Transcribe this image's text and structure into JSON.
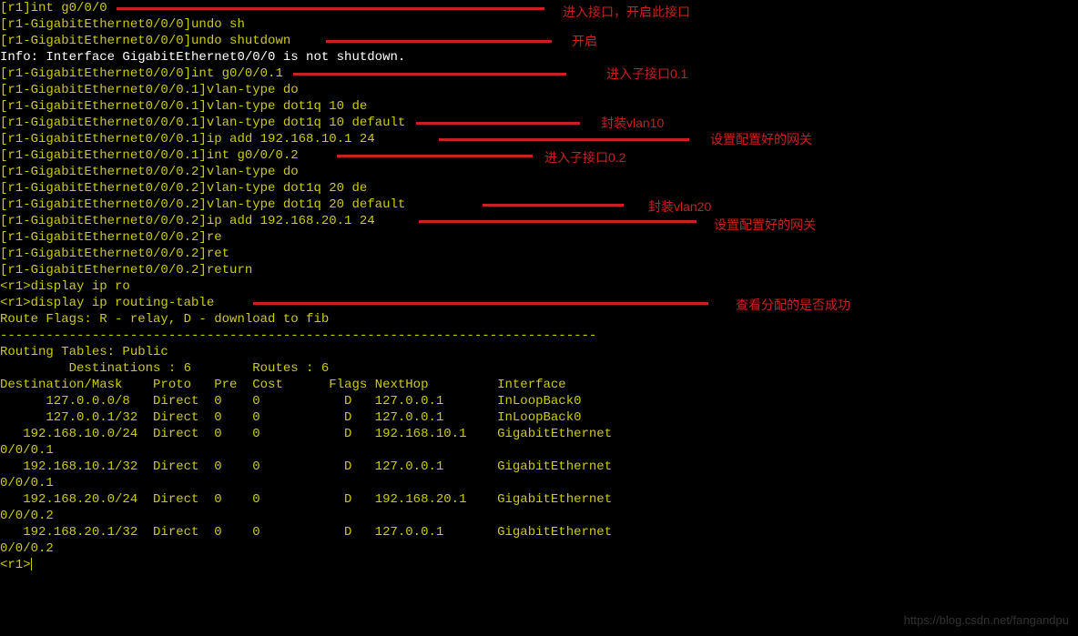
{
  "lines": {
    "l0": "[r1]int g0/0/0",
    "l1": "[r1-GigabitEthernet0/0/0]undo sh",
    "l2": "[r1-GigabitEthernet0/0/0]undo shutdown",
    "l3": "Info: Interface GigabitEthernet0/0/0 is not shutdown.",
    "l4": "[r1-GigabitEthernet0/0/0]int g0/0/0.1",
    "l5": "[r1-GigabitEthernet0/0/0.1]vlan-type do",
    "l6": "[r1-GigabitEthernet0/0/0.1]vlan-type dot1q 10 de",
    "l7": "[r1-GigabitEthernet0/0/0.1]vlan-type dot1q 10 default",
    "l8": "[r1-GigabitEthernet0/0/0.1]ip add 192.168.10.1 24",
    "l9": "[r1-GigabitEthernet0/0/0.1]int g0/0/0.2",
    "l10": "[r1-GigabitEthernet0/0/0.2]vlan-type do",
    "l11": "[r1-GigabitEthernet0/0/0.2]vlan-type dot1q 20 de",
    "l12": "[r1-GigabitEthernet0/0/0.2]vlan-type dot1q 20 default",
    "l13": "[r1-GigabitEthernet0/0/0.2]ip add 192.168.20.1 24",
    "l14": "[r1-GigabitEthernet0/0/0.2]re",
    "l15": "[r1-GigabitEthernet0/0/0.2]ret",
    "l16": "[r1-GigabitEthernet0/0/0.2]return",
    "l17": "<r1>display ip ro",
    "l18": "<r1>display ip routing-table",
    "l19": "Route Flags: R - relay, D - download to fib",
    "l20": "------------------------------------------------------------------------------",
    "l21": "Routing Tables: Public",
    "l22": "         Destinations : 6        Routes : 6",
    "l23": "",
    "l24": "Destination/Mask    Proto   Pre  Cost      Flags NextHop         Interface",
    "l25": "",
    "l26": "      127.0.0.0/8   Direct  0    0           D   127.0.0.1       InLoopBack0",
    "l27": "      127.0.0.1/32  Direct  0    0           D   127.0.0.1       InLoopBack0",
    "l28": "   192.168.10.0/24  Direct  0    0           D   192.168.10.1    GigabitEthernet",
    "l29": "0/0/0.1",
    "l30": "   192.168.10.1/32  Direct  0    0           D   127.0.0.1       GigabitEthernet",
    "l31": "0/0/0.1",
    "l32": "   192.168.20.0/24  Direct  0    0           D   192.168.20.1    GigabitEthernet",
    "l33": "0/0/0.2",
    "l34": "   192.168.20.1/32  Direct  0    0           D   127.0.0.1       GigabitEthernet",
    "l35": "0/0/0.2",
    "l36": "",
    "l37": "<r1>"
  },
  "annotations": {
    "a0": "进入接口，开启此接口",
    "a1": "开启",
    "a2": "进入子接口0.1",
    "a3": "封装vlan10",
    "a4": "设置配置好的网关",
    "a5": "进入子接口0.2",
    "a6": "封装vlan20",
    "a7": "设置配置好的网关",
    "a8": "查看分配的是否成功"
  },
  "watermark": "https://blog.csdn.net/fangandpu"
}
